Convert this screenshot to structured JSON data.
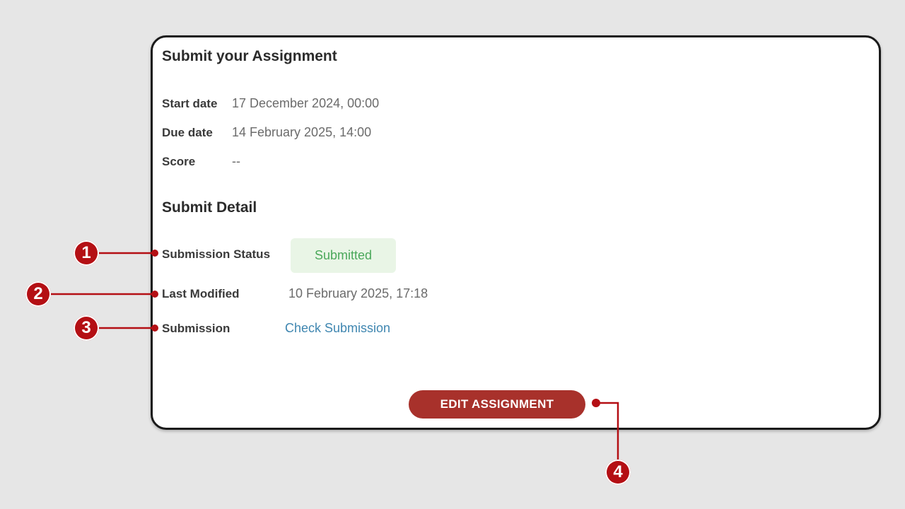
{
  "card": {
    "title": "Submit your Assignment",
    "start_date_label": "Start date",
    "start_date_value": "17 December 2024, 00:00",
    "due_date_label": "Due date",
    "due_date_value": "14 February 2025, 14:00",
    "score_label": "Score",
    "score_value": "--",
    "detail_title": "Submit Detail",
    "submission_status_label": "Submission Status",
    "submission_status_value": "Submitted",
    "last_modified_label": "Last Modified",
    "last_modified_value": "10 February 2025, 17:18",
    "submission_label": "Submission",
    "submission_link": "Check Submission",
    "edit_button": "EDIT ASSIGNMENT"
  },
  "callouts": [
    "1",
    "2",
    "3",
    "4"
  ],
  "colors": {
    "accent": "#a8312b",
    "callout": "#b40f14",
    "status_bg": "#e9f5e6",
    "status_text": "#4aa85a",
    "link": "#3f86b0"
  }
}
